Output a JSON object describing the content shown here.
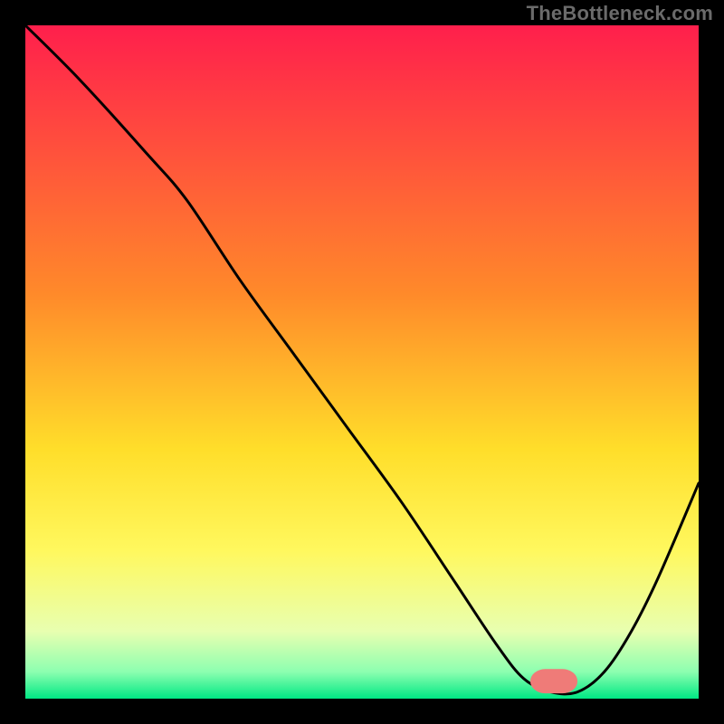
{
  "watermark": "TheBottleneck.com",
  "chart_data": {
    "type": "line",
    "title": "",
    "xlabel": "",
    "ylabel": "",
    "xlim": [
      0,
      100
    ],
    "ylim": [
      0,
      100
    ],
    "background_gradient_stops": [
      {
        "offset": 0.0,
        "color": "#ff1f4c"
      },
      {
        "offset": 0.4,
        "color": "#ff8a2a"
      },
      {
        "offset": 0.63,
        "color": "#ffde2a"
      },
      {
        "offset": 0.78,
        "color": "#fff85e"
      },
      {
        "offset": 0.9,
        "color": "#e8ffb0"
      },
      {
        "offset": 0.96,
        "color": "#8dffb0"
      },
      {
        "offset": 1.0,
        "color": "#00e884"
      }
    ],
    "curve": {
      "x": [
        0,
        8,
        18,
        24,
        32,
        40,
        48,
        56,
        64,
        70,
        74,
        78,
        82,
        86,
        90,
        94,
        100
      ],
      "y": [
        100,
        92,
        81,
        74,
        62,
        51,
        40,
        29,
        17,
        8,
        3,
        1,
        1,
        4,
        10,
        18,
        32
      ]
    },
    "marker": {
      "x0": 75,
      "x1": 82,
      "y": 2.6,
      "color": "#ef7b78",
      "radius": 2.2,
      "height": 3.6
    }
  }
}
